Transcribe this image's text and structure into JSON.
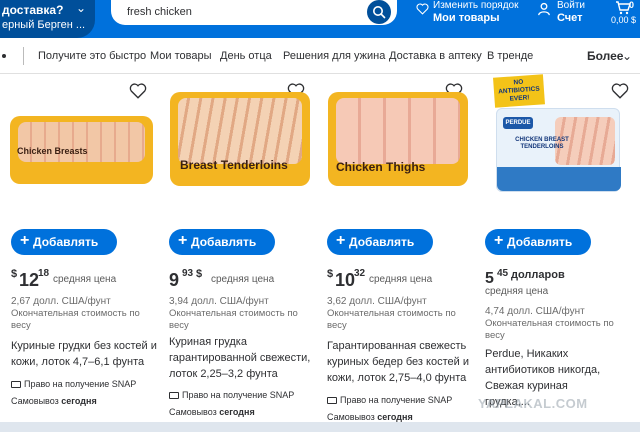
{
  "header": {
    "location_line1": "доставка?",
    "location_line2": "ерный Берген ...",
    "search_value": "fresh chicken",
    "reorder_line1": "Изменить порядок",
    "reorder_line2": "Мои товары",
    "account_line1": "Войти",
    "account_line2": "Счет",
    "cart_count": "0",
    "cart_total": "0,00 $"
  },
  "nav": {
    "items": [
      "Получите это быстро",
      "Мои товары",
      "День отца",
      "Решения для ужина",
      "Доставка в аптеку",
      "В тренде"
    ],
    "more": "Более"
  },
  "products": [
    {
      "image_label": "Chicken Breasts",
      "add_label": "Добавлять",
      "price_currency": "$",
      "price_dollars": "12",
      "price_cents": "18",
      "avg_label": "средняя цена",
      "unit_price": "2,67 долл. США/фунт",
      "final_note": "Окончательная стоимость по весу",
      "title": "Куриные грудки без костей и кожи, лоток 4,7–6,1 фунта",
      "snap": "Право на получение SNAP",
      "pickup_prefix": "Самовывоз",
      "pickup_day": "сегодня"
    },
    {
      "image_label": "Breast Tenderloins",
      "add_label": "Добавлять",
      "price_dollars": "9",
      "price_cents": "93",
      "price_currency": "$",
      "avg_label": "средняя цена",
      "unit_price": "3,94 долл. США/фунт",
      "final_note": "Окончательная стоимость по весу",
      "title": "Куриная грудка гарантированной свежести, лоток 2,25–3,2 фунта",
      "snap": "Право на получение SNAP",
      "pickup_prefix": "Самовывоз",
      "pickup_day": "сегодня"
    },
    {
      "image_label": "Chicken Thighs",
      "add_label": "Добавлять",
      "price_currency": "$",
      "price_dollars": "10",
      "price_cents": "32",
      "avg_label": "средняя цена",
      "unit_price": "3,62 долл. США/фунт",
      "final_note": "Окончательная стоимость по весу",
      "title": "Гарантированная свежесть куриных бедер без костей и кожи, лоток 2,75–4,0 фунта",
      "snap": "Право на получение SNAP",
      "pickup_prefix": "Самовывоз",
      "pickup_day": "сегодня"
    },
    {
      "image_label": "CHICKEN BREAST TENDERLOINS",
      "badge": "NO ANTIBIOTICS EVER!",
      "brand": "PERDUE",
      "add_label": "Добавлять",
      "price_dollars": "5",
      "price_cents": "45",
      "price_unit_word": "долларов",
      "avg_label": "средняя цена",
      "unit_price": "4,74 долл. США/фунт",
      "final_note": "Окончательная стоимость по весу",
      "title": "Perdue, Никаких антибиотиков никогда, Свежая куриная грудка,..."
    }
  ],
  "watermark": "YAPLAKAL.COM"
}
